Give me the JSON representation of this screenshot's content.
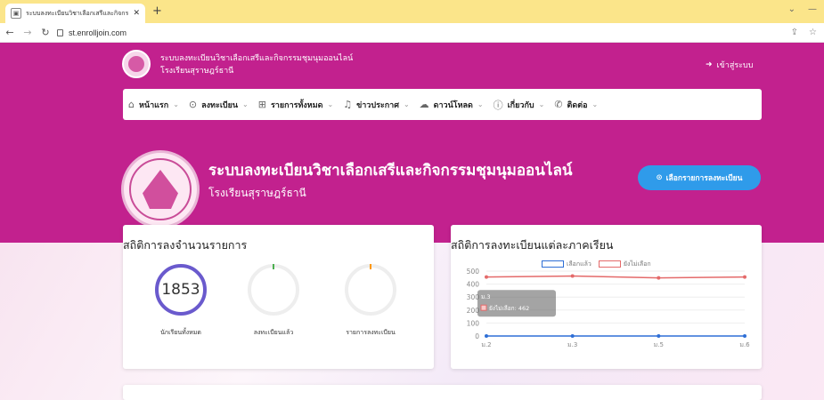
{
  "browser": {
    "tab_title": "ระบบลงทะเบียนวิชาเลือกเสรีและกิจกรรม",
    "url": "st.enrolljoin.com"
  },
  "header": {
    "title_line1": "ระบบลงทะเบียนวิชาเลือกเสรีและกิจกรรมชุมนุมออนไลน์",
    "title_line2": "โรงเรียนสุราษฎร์ธานี",
    "login_label": "เข้าสู่ระบบ"
  },
  "menu": [
    {
      "label": "หน้าแรก",
      "icon": "home-icon"
    },
    {
      "label": "ลงทะเบียน",
      "icon": "check-circle-icon"
    },
    {
      "label": "รายการทั้งหมด",
      "icon": "grid-icon"
    },
    {
      "label": "ข่าวประกาศ",
      "icon": "bell-icon"
    },
    {
      "label": "ดาวน์โหลด",
      "icon": "cloud-download-icon"
    },
    {
      "label": "เกี่ยวกับ",
      "icon": "info-icon"
    },
    {
      "label": "ติดต่อ",
      "icon": "phone-icon"
    }
  ],
  "hero": {
    "title": "ระบบลงทะเบียนวิชาเลือกเสรีและกิจกรรมชุมนุมออนไลน์",
    "subtitle": "โรงเรียนสุราษฎร์ธานี",
    "cta_label": "เลือกรายการลงทะเบียน"
  },
  "stats_card": {
    "title": "สถิติการลงจำนวนรายการ",
    "items": [
      {
        "value": "1853",
        "label": "นักเรียนทั้งหมด"
      },
      {
        "value": "",
        "label": "ลงทะเบียนแล้ว"
      },
      {
        "value": "",
        "label": "รายการลงทะเบียน"
      }
    ],
    "colors": {
      "ring_active": "#6a5acd",
      "tick_green": "#4caf50",
      "tick_orange": "#ff9800"
    }
  },
  "chart_card": {
    "title": "สถิติการลงทะเบียนแต่ละภาคเรียน",
    "tooltip": {
      "title": "ม.3",
      "line": "ยังไม่เลือก: 462"
    }
  },
  "chart_data": {
    "type": "line",
    "categories": [
      "ม.2",
      "ม.3",
      "ม.5",
      "ม.6"
    ],
    "series": [
      {
        "name": "เลือกแล้ว",
        "values": [
          0,
          0,
          0,
          0
        ],
        "color": "#2f6fd6"
      },
      {
        "name": "ยังไม่เลือก",
        "values": [
          455,
          462,
          448,
          455
        ],
        "color": "#e46a6a"
      }
    ],
    "ylim": [
      0,
      500
    ],
    "yticks": [
      0,
      100,
      200,
      300,
      400,
      500
    ]
  },
  "colors": {
    "brand": "#c2218e",
    "cta": "#2f9bea",
    "tabbar": "#fbe58a"
  }
}
